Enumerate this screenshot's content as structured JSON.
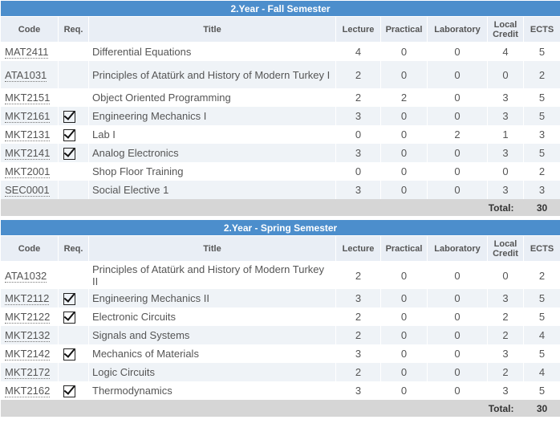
{
  "columns": {
    "code": "Code",
    "req": "Req.",
    "title": "Title",
    "lecture": "Lecture",
    "practical": "Practical",
    "laboratory": "Laboratory",
    "local_credit": "Local Credit",
    "ects": "ECTS"
  },
  "total_label": "Total:",
  "semesters": [
    {
      "title": "2.Year - Fall Semester",
      "total": "30",
      "courses": [
        {
          "code": "MAT2411",
          "required": false,
          "title": "Differential Equations",
          "lecture": "4",
          "practical": "0",
          "laboratory": "0",
          "local_credit": "4",
          "ects": "5"
        },
        {
          "code": "ATA1031",
          "required": false,
          "title": "Principles of Atatürk and History of Modern Turkey I",
          "lecture": "2",
          "practical": "0",
          "laboratory": "0",
          "local_credit": "0",
          "ects": "2"
        },
        {
          "code": "MKT2151",
          "required": false,
          "title": "Object Oriented Programming",
          "lecture": "2",
          "practical": "2",
          "laboratory": "0",
          "local_credit": "3",
          "ects": "5"
        },
        {
          "code": "MKT2161",
          "required": true,
          "title": "Engineering Mechanics I",
          "lecture": "3",
          "practical": "0",
          "laboratory": "0",
          "local_credit": "3",
          "ects": "5"
        },
        {
          "code": "MKT2131",
          "required": true,
          "title": "Lab I",
          "lecture": "0",
          "practical": "0",
          "laboratory": "2",
          "local_credit": "1",
          "ects": "3"
        },
        {
          "code": "MKT2141",
          "required": true,
          "title": "Analog Electronics",
          "lecture": "3",
          "practical": "0",
          "laboratory": "0",
          "local_credit": "3",
          "ects": "5"
        },
        {
          "code": "MKT2001",
          "required": false,
          "title": "Shop Floor Training",
          "lecture": "0",
          "practical": "0",
          "laboratory": "0",
          "local_credit": "0",
          "ects": "2"
        },
        {
          "code": "SEC0001",
          "required": false,
          "title": "Social Elective 1",
          "lecture": "3",
          "practical": "0",
          "laboratory": "0",
          "local_credit": "3",
          "ects": "3"
        }
      ]
    },
    {
      "title": "2.Year - Spring Semester",
      "total": "30",
      "courses": [
        {
          "code": "ATA1032",
          "required": false,
          "title": "Principles of Atatürk and History of Modern Turkey II",
          "lecture": "2",
          "practical": "0",
          "laboratory": "0",
          "local_credit": "0",
          "ects": "2"
        },
        {
          "code": "MKT2112",
          "required": true,
          "title": "Engineering Mechanics II",
          "lecture": "3",
          "practical": "0",
          "laboratory": "0",
          "local_credit": "3",
          "ects": "5"
        },
        {
          "code": "MKT2122",
          "required": true,
          "title": "Electronic Circuits",
          "lecture": "2",
          "practical": "0",
          "laboratory": "0",
          "local_credit": "2",
          "ects": "5"
        },
        {
          "code": "MKT2132",
          "required": false,
          "title": "Signals and Systems",
          "lecture": "2",
          "practical": "0",
          "laboratory": "0",
          "local_credit": "2",
          "ects": "4"
        },
        {
          "code": "MKT2142",
          "required": true,
          "title": "Mechanics of Materials",
          "lecture": "3",
          "practical": "0",
          "laboratory": "0",
          "local_credit": "3",
          "ects": "5"
        },
        {
          "code": "MKT2172",
          "required": false,
          "title": "Logic Circuits",
          "lecture": "2",
          "practical": "0",
          "laboratory": "0",
          "local_credit": "2",
          "ects": "4"
        },
        {
          "code": "MKT2162",
          "required": true,
          "title": "Thermodynamics",
          "lecture": "3",
          "practical": "0",
          "laboratory": "0",
          "local_credit": "3",
          "ects": "5"
        }
      ]
    }
  ]
}
